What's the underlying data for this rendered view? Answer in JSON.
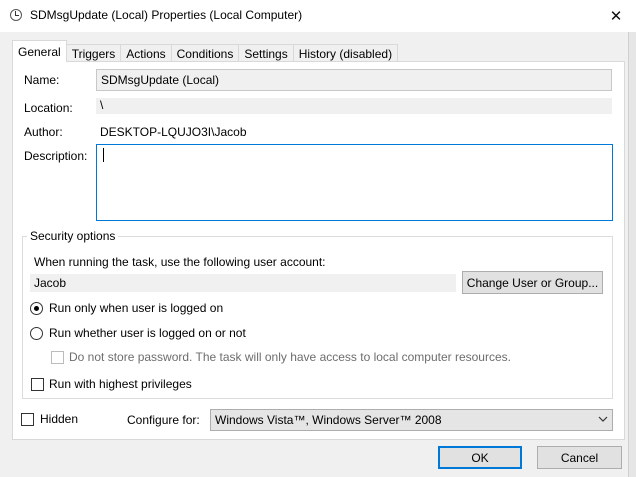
{
  "window": {
    "title": "SDMsgUpdate (Local) Properties (Local Computer)",
    "close_glyph": "✕"
  },
  "tabs": [
    {
      "label": "General",
      "active": true
    },
    {
      "label": "Triggers"
    },
    {
      "label": "Actions"
    },
    {
      "label": "Conditions"
    },
    {
      "label": "Settings"
    },
    {
      "label": "History (disabled)"
    }
  ],
  "general": {
    "name_label": "Name:",
    "name_value": "SDMsgUpdate (Local)",
    "location_label": "Location:",
    "location_value": "\\",
    "author_label": "Author:",
    "author_value": "DESKTOP-LQUJO3I\\Jacob",
    "description_label": "Description:",
    "description_value": ""
  },
  "security": {
    "group_title": "Security options",
    "account_prompt": "When running the task, use the following user account:",
    "account_value": "Jacob",
    "change_button": "Change User or Group...",
    "run_logged_on": "Run only when user is logged on",
    "run_whether": "Run whether user is logged on or not",
    "no_store_password": "Do not store password.  The task will only have access to local computer resources.",
    "highest_privileges": "Run with highest privileges",
    "selected_run_option": "run_logged_on"
  },
  "bottom": {
    "hidden_label": "Hidden",
    "configure_label": "Configure for:",
    "configure_value": "Windows Vista™, Windows Server™ 2008"
  },
  "buttons": {
    "ok": "OK",
    "cancel": "Cancel"
  },
  "colors": {
    "accent": "#0078d7",
    "dialog_bg": "#f0f0f0",
    "panel_bg": "#ffffff"
  }
}
